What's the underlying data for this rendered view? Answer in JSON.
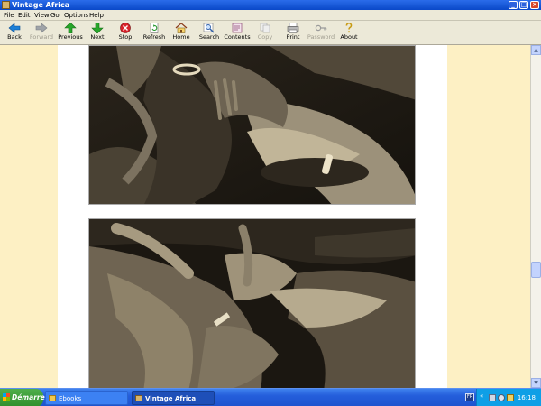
{
  "window": {
    "title": "Vintage Africa"
  },
  "menubar": {
    "items": [
      "File",
      "Edit",
      "View",
      "Go",
      "Options",
      "Help"
    ]
  },
  "toolbar": {
    "buttons": [
      {
        "label": "Back",
        "icon": "back-arrow-icon",
        "enabled": true
      },
      {
        "label": "Forward",
        "icon": "forward-arrow-icon",
        "enabled": false
      },
      {
        "label": "Previous",
        "icon": "up-arrow-icon",
        "enabled": true
      },
      {
        "label": "Next",
        "icon": "down-arrow-icon",
        "enabled": true
      },
      {
        "label": "Stop",
        "icon": "stop-icon",
        "enabled": true
      },
      {
        "label": "Refresh",
        "icon": "refresh-icon",
        "enabled": true
      },
      {
        "label": "Home",
        "icon": "home-icon",
        "enabled": true
      },
      {
        "label": "Search",
        "icon": "search-icon",
        "enabled": true
      },
      {
        "label": "Contents",
        "icon": "contents-icon",
        "enabled": true
      },
      {
        "label": "Copy",
        "icon": "copy-icon",
        "enabled": false
      },
      {
        "label": "Print",
        "icon": "print-icon",
        "enabled": true
      },
      {
        "label": "Password",
        "icon": "key-icon",
        "enabled": false
      },
      {
        "label": "About",
        "icon": "about-icon",
        "enabled": true
      }
    ]
  },
  "content": {
    "background_color": "#fdf0c4",
    "page_color": "#ffffff",
    "photos": [
      {
        "name": "photo-1",
        "tone": "sepia black-and-white"
      },
      {
        "name": "photo-2",
        "tone": "sepia black-and-white"
      }
    ]
  },
  "taskbar": {
    "start_label": "Démarrer",
    "tasks": [
      {
        "label": "Ebooks",
        "active": false
      },
      {
        "label": "Vintage Africa",
        "active": true
      }
    ],
    "tray": {
      "lang": "FR",
      "clock": "16:18"
    }
  },
  "colors": {
    "titlebar": "#0a48c8",
    "taskbar": "#245edb",
    "start": "#2f8f2c",
    "tray": "#0f9fe6"
  }
}
